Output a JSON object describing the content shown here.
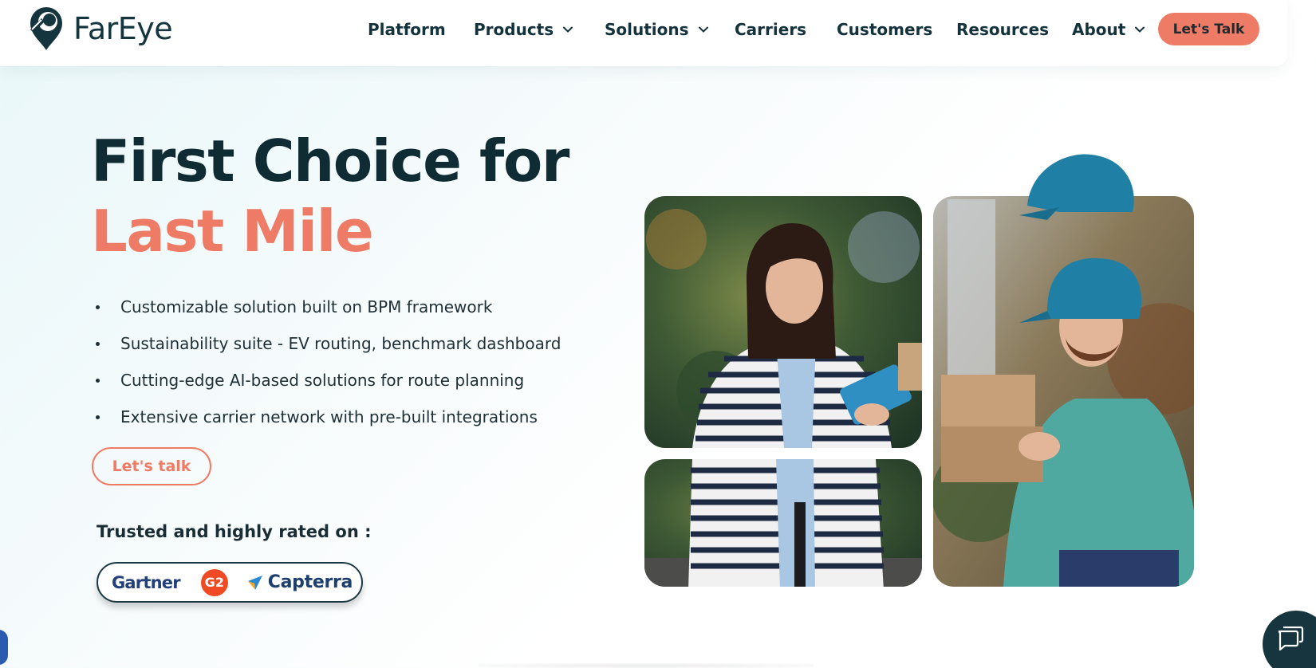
{
  "brand": {
    "name": "FarEye",
    "accent": "#ee7b66",
    "dark": "#0f2b33"
  },
  "nav": {
    "items": [
      {
        "label": "Platform",
        "has_dropdown": false
      },
      {
        "label": "Products",
        "has_dropdown": true
      },
      {
        "label": "Solutions",
        "has_dropdown": true
      },
      {
        "label": "Carriers",
        "has_dropdown": false
      },
      {
        "label": "Customers",
        "has_dropdown": false
      },
      {
        "label": "Resources",
        "has_dropdown": false
      },
      {
        "label": "About",
        "has_dropdown": true
      }
    ],
    "cta_label": "Let's Talk"
  },
  "hero": {
    "headline_line1": "First Choice for",
    "headline_line2": "Last Mile",
    "bullets": [
      "Customizable solution built on BPM framework",
      "Sustainability suite - EV routing, benchmark dashboard",
      "Cutting-edge AI-based solutions for route planning",
      "Extensive carrier network with pre-built integrations"
    ],
    "cta_label": "Let's talk",
    "trusted_text": "Trusted and highly rated on :",
    "ratings": {
      "gartner": "Gartner",
      "g2": "G2",
      "capterra": "Capterra"
    }
  },
  "icons": {
    "logo": "fareye-pin-icon",
    "dropdown": "chevron-down-icon",
    "chat": "chat-bubble-icon"
  }
}
